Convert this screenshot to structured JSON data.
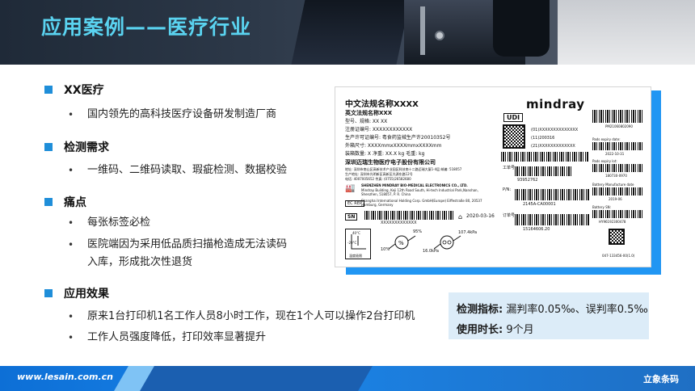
{
  "title": "应用案例——医疗行业",
  "sections": [
    {
      "title": "XX医疗",
      "items": [
        "国内领先的高科技医疗设备研发制造厂商"
      ]
    },
    {
      "title": "检测需求",
      "items": [
        "一维码、二维码读取、瑕疵检测、数据校验"
      ]
    },
    {
      "title": "痛点",
      "items": [
        "每张标签必检",
        "医院端因为采用低品质扫描枪造成无法读码",
        "入库，形成批次性退货"
      ]
    },
    {
      "title": "应用效果",
      "items": [
        "原来1台打印机1名工作人员8小时工作，现在1个人可以操作2台打印机",
        "工作人员强度降低，打印效率显著提升"
      ]
    }
  ],
  "label": {
    "title_cn": "中文法规名称XXXX",
    "title_en": "英文法规名称XXX",
    "brand": "mindray",
    "udi": "UDI",
    "lines": [
      "型号、规格: XX XX",
      "注册证编号: XXXXXXXXXXXX",
      "生产许可证编号: 粤食药监械生产许20010352号",
      "外箱尺寸: XXXXmmxXXXXmmxXXXXmm",
      "装箱数量: X          净重: XX.X kg          毛重: kg"
    ],
    "company_cn": "深圳迈瑞生物医疗电子股份有限公司",
    "company_small": "地址: 深圳市南山区高新技术产业园区科技南十二路迈瑞大厦1-4层  邮编: 518057",
    "company_small2": "生产地址: 深圳市光明新区高新区光源东路12号",
    "company_small3": "电话: 4007005652    传真: (0755)26582680",
    "mfr_en": "SHENZHEN MINDRAY BIO-MEDICAL ELECTRONICS CO., LTD.",
    "mfr_addr": "Mindray Building, Keji 12th Road South, Hi-tech Industrial Park,Nanshan, Shenzhen, 518057, P. R. China",
    "ec_rep": "EC  REP",
    "rep_addr": "Shanghai International Holding Corp. GmbH(Europe) Eiffestraße 80, 20537 Hamburg, Germany",
    "sn_label": "SN",
    "sn_value": "XXXXXXXXXXXXX",
    "date": "2020-03-16",
    "humidity_top": "95%",
    "humidity_bottom": "10%",
    "pressure_top": "107.4kPa",
    "pressure_bottom": "16.0kPa",
    "temp_label": "温度极限",
    "udi_lines": [
      "(01)XXXXXXXXXXXXXX",
      "(11)200316",
      "(21)XXXXXXXXXXXXX"
    ],
    "work_no_label": "工单号:",
    "work_no": "93952762",
    "pn_label": "P/N:",
    "pn": "2145A-CA00001",
    "order_label": "订单号:",
    "order": "15164606.20",
    "pads_code": "PM21060802090",
    "pads_expiry_label": "Pads expiry date:",
    "pads_expiry": "2022-10-31",
    "pads_lot_label": "Pads expiry lot:",
    "pads_lot": "180730-0970",
    "battery_date_label": "Battery Manufacture date",
    "battery_date": "2019-06",
    "battery_sn_label": "Battery SN:",
    "battery_sn": "HY96192300478",
    "doc_no": "047-133456-00(1.0)",
    "temp_top": "40°C",
    "temp_bottom": "-20°C"
  },
  "metrics": [
    {
      "key": "检测指标:",
      "value": "漏判率0.05‰、误判率0.5‰"
    },
    {
      "key": "使用时长:",
      "value": "9个月"
    }
  ],
  "footer": {
    "url": "www.lesain.com.cn",
    "brand": "立象条码"
  },
  "colors": {
    "title": "#5ad3f0",
    "accent": "#1f8ed9",
    "footer": "#1a84e8",
    "metrics_bg": "#dcecf8"
  }
}
